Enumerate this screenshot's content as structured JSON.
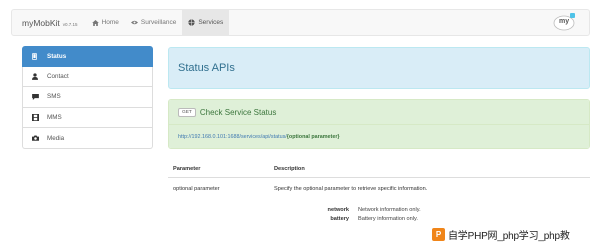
{
  "navbar": {
    "brand_name": "myMobKit",
    "brand_version": "v0.7.15",
    "items": [
      {
        "label": "Home",
        "icon": "home-icon",
        "active": false
      },
      {
        "label": "Surveillance",
        "icon": "eye-icon",
        "active": false
      },
      {
        "label": "Services",
        "icon": "globe-icon",
        "active": true
      }
    ],
    "logo_text": "my"
  },
  "sidebar": {
    "items": [
      {
        "label": "Status",
        "icon": "phone-icon",
        "active": true
      },
      {
        "label": "Contact",
        "icon": "user-icon",
        "active": false
      },
      {
        "label": "SMS",
        "icon": "comment-icon",
        "active": false
      },
      {
        "label": "MMS",
        "icon": "film-icon",
        "active": false
      },
      {
        "label": "Media",
        "icon": "camera-icon",
        "active": false
      }
    ]
  },
  "main": {
    "title": "Status APIs",
    "api": {
      "method": "GET",
      "title": "Check Service Status",
      "url_base": "http://192.168.0.101:1688/services/api/status/",
      "url_param": "{optional parameter}"
    },
    "table": {
      "headers": [
        "Parameter",
        "Description"
      ],
      "rows": [
        {
          "parameter": "optional parameter",
          "description": "Specify the optional parameter to retrieve specific information."
        }
      ],
      "sub_params": [
        {
          "key": "network",
          "value": "Network information only."
        },
        {
          "key": "battery",
          "value": "Battery information only."
        }
      ]
    }
  },
  "watermark": {
    "logo_letter": "P",
    "text": "自学PHP网_php学习_php教"
  },
  "colors": {
    "accent": "#428bca",
    "title_panel_bg": "#d9edf7",
    "title_text": "#31708f",
    "api_panel_bg": "#dff0d8",
    "api_text": "#3c763d",
    "watermark_orange": "#f08519"
  }
}
